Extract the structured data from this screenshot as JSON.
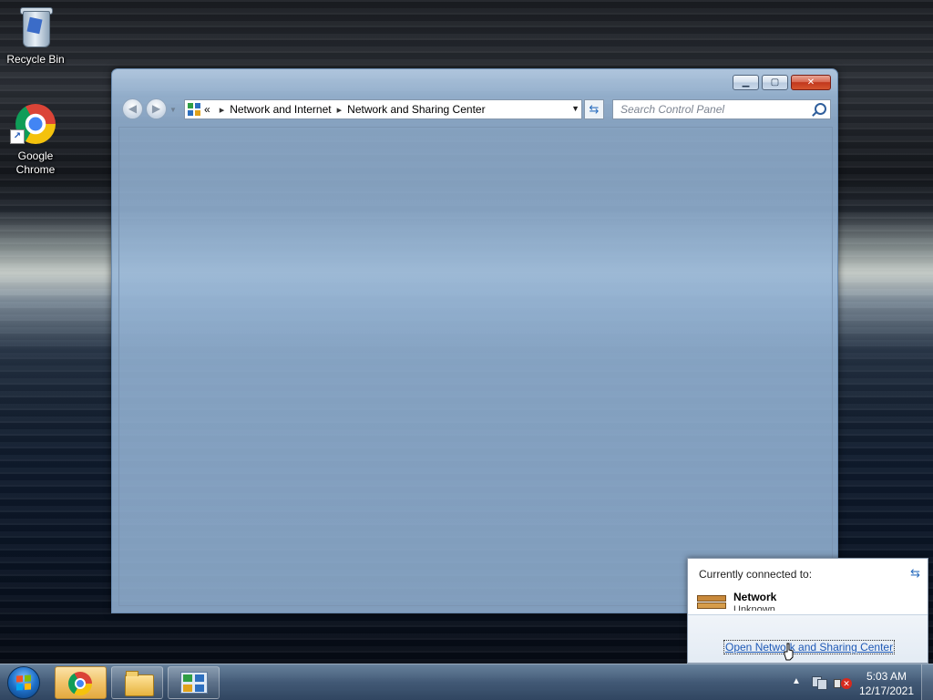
{
  "desktop": {
    "icons": [
      {
        "label": "Recycle Bin",
        "icon": "recycle-bin-icon"
      },
      {
        "label": "Google Chrome",
        "icon": "chrome-icon"
      }
    ]
  },
  "window": {
    "breadcrumb": {
      "overflow": "«",
      "items": [
        "Network and Internet",
        "Network and Sharing Center"
      ]
    },
    "search_placeholder": "Search Control Panel",
    "controls": {
      "minimize": "minimize-icon",
      "maximize": "maximize-icon",
      "close": "close-icon"
    }
  },
  "network_flyout": {
    "title": "Currently connected to:",
    "network_name": "Network",
    "network_status": "Unknown",
    "link": "Open Network and Sharing Center"
  },
  "taskbar": {
    "pinned": [
      "chrome-icon",
      "windows-explorer-icon",
      "control-panel-icon"
    ],
    "clock": {
      "time": "5:03 AM",
      "date": "12/17/2021"
    }
  },
  "colors": {
    "link": "#1e59b6",
    "taskbar": "#465f7d",
    "active_button": "#f1c36a"
  }
}
